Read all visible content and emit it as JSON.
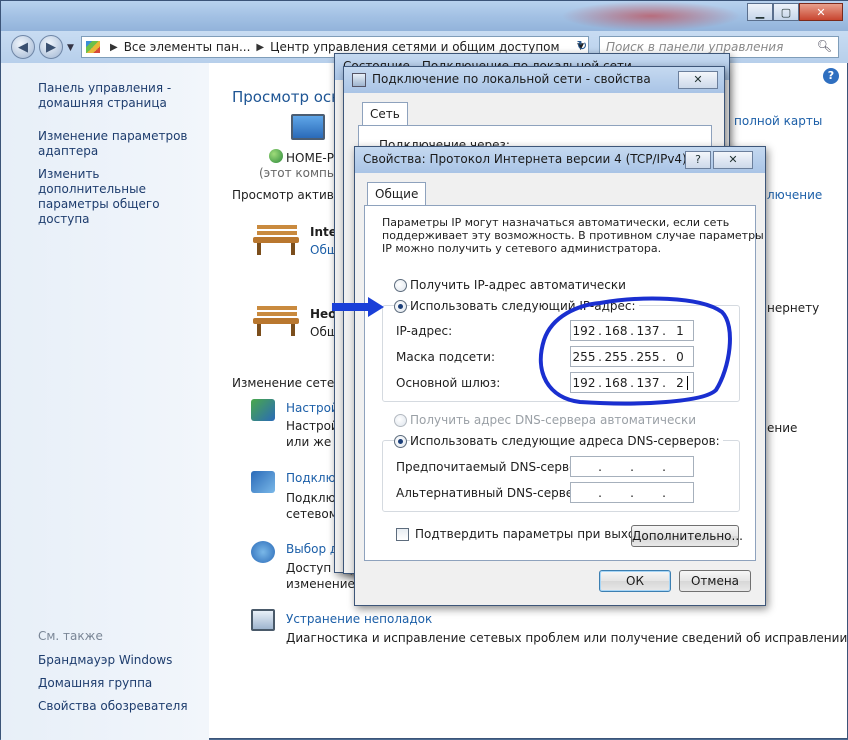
{
  "colors": {
    "accent": "#1c5fa8",
    "annotation": "#1a2fd0",
    "arrow": "#1a3fd8"
  },
  "nav": {
    "breadcrumb": [
      "Все элементы пан...",
      "Центр управления сетями и общим доступом"
    ],
    "search_placeholder": "Поиск в панели управления"
  },
  "sidebar": {
    "items": [
      {
        "label": "Панель управления -\nдомашняя страница"
      },
      {
        "label": "Изменение параметров\nадаптера"
      },
      {
        "label": "Изменить дополнительные\nпараметры общего доступа"
      }
    ],
    "see_also_title": "См. также",
    "see_also": [
      "Брандмауэр Windows",
      "Домашняя группа",
      "Свойства обозревателя"
    ]
  },
  "content": {
    "heading": "Просмотр осно",
    "computer_name": "HOME-PC",
    "computer_sub": "(этот компьют",
    "full_map_link": "полной карты",
    "active_networks": "Просмотр активны",
    "connect_link": "лючение",
    "net1_name": "Intern",
    "net1_type": "Общ",
    "net2_name": "Неоп",
    "net2_type": "Общ",
    "net2_right": "нернету",
    "change_settings": "Изменение сетевы",
    "task1_link": "Настрой",
    "task1_desc1": "Настрой",
    "task1_desc2": "или же н",
    "task1_right": "ение",
    "task2_link": "Подклю",
    "task2_desc1": "Подклю",
    "task2_desc2": "сетевому со",
    "task3_link": "Выбор дома",
    "task3_desc1": "Доступ к фа",
    "task3_desc2": "изменение п",
    "task4_link": "Устранение неполадок",
    "task4_desc": "Диагностика и исправление сетевых проблем или получение сведений об исправлении."
  },
  "status_dialog": {
    "title": "Состояние - Подключение по локальной сети"
  },
  "props_dialog": {
    "title": "Подключение по локальной сети - свойства",
    "tab": "Сеть",
    "connect_via": "Подключение через:"
  },
  "ipv4_dialog": {
    "title": "Свойства: Протокол Интернета версии 4 (TCP/IPv4)",
    "help_btn": "?",
    "close_btn": "✕",
    "tab": "Общие",
    "description": [
      "Параметры IP могут назначаться автоматически, если сеть",
      "поддерживает эту возможность. В противном случае параметры",
      "IP можно получить у сетевого администратора."
    ],
    "radio_auto_ip": "Получить IP-адрес автоматически",
    "radio_manual_ip": "Использовать следующий IP-адрес:",
    "ip_label": "IP-адрес:",
    "mask_label": "Маска подсети:",
    "gateway_label": "Основной шлюз:",
    "ip": [
      "192",
      "168",
      "137",
      "1"
    ],
    "mask": [
      "255",
      "255",
      "255",
      "0"
    ],
    "gateway": [
      "192",
      "168",
      "137",
      "2"
    ],
    "radio_auto_dns": "Получить адрес DNS-сервера автоматически",
    "radio_manual_dns": "Использовать следующие адреса DNS-серверов:",
    "dns1_label": "Предпочитаемый DNS-сервер:",
    "dns2_label": "Альтернативный DNS-сервер:",
    "dns1": [
      "",
      "",
      "",
      ""
    ],
    "dns2": [
      "",
      "",
      "",
      ""
    ],
    "validate_label": "Подтвердить параметры при выходе",
    "advanced_btn": "Дополнительно...",
    "ok_btn": "ОК",
    "cancel_btn": "Отмена"
  }
}
